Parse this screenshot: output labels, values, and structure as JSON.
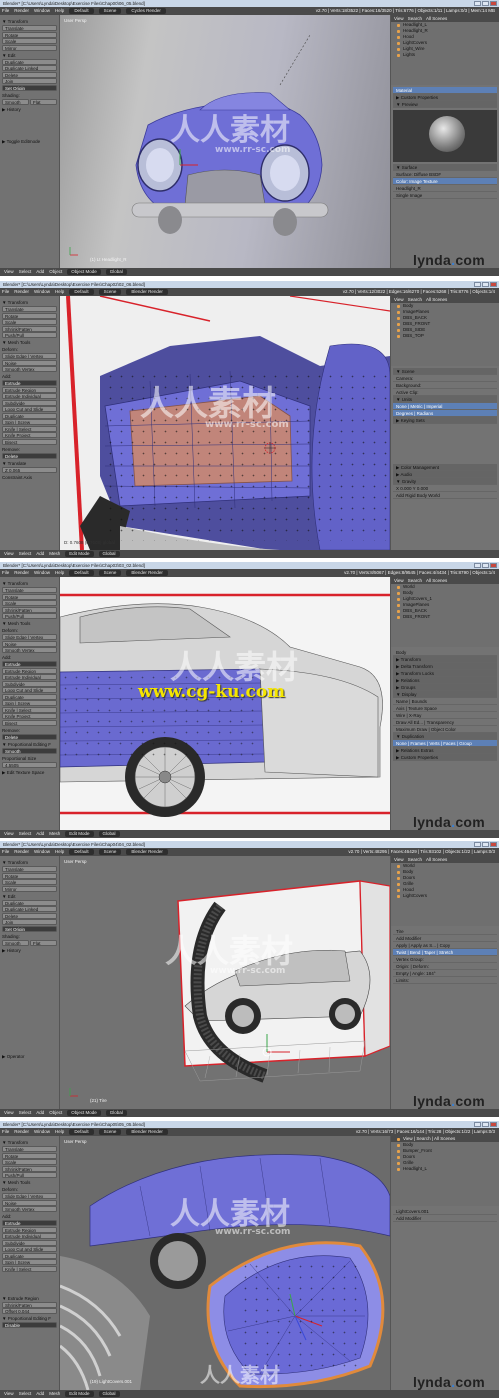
{
  "panels": [
    {
      "title": "Blender* [C:\\Users\\Lynda\\Desktop\\Exercise Files\\Chap00\\06_05.blend]",
      "menu": [
        "File",
        "Render",
        "Window",
        "Help"
      ],
      "layout": "Default",
      "scene": "Scene",
      "engine": "Cycles Render",
      "stats": "v2.70 | Verts:18/3522 | Faces:16/3520 | Tris:6776 | Objects:1/11 | Lamps:0/3 | Mem:14 MB",
      "viewport_label": "User Persp",
      "viewport_bottom": "(1) Lt Headlight_R",
      "mode": "Object Mode",
      "orientation": "Global",
      "bottom_menu": [
        "View",
        "Select",
        "Add",
        "Object"
      ],
      "tools": {
        "sections": [
          {
            "header": "▼ Transform",
            "buttons": [
              "Translate",
              "Rotate",
              "Scale",
              "Mirror"
            ]
          },
          {
            "header": "▼ Edit",
            "buttons": [
              "Duplicate",
              "Duplicate Linked",
              "Delete",
              "Join"
            ]
          },
          {
            "header": "",
            "buttons": [
              "Set Origin"
            ]
          },
          {
            "header": "Shading:",
            "buttons": [
              "Smooth",
              "Flat"
            ]
          },
          {
            "header": "▶ History",
            "buttons": []
          },
          {
            "header": "▶ Toggle Editmode",
            "buttons": []
          }
        ]
      },
      "outliner": [
        "Headlight_L",
        "Headlight_R",
        "Hood",
        "LightCovers",
        "Light_Wire",
        "Lights"
      ],
      "props": [
        "Material",
        "▶ Custom Properties",
        "▼ Preview",
        "▼ Surface",
        "Surface: Diffuse BSDF",
        "Color: Image Texture",
        "Headlight_R",
        "Single Image"
      ],
      "show_lynda": true
    },
    {
      "title": "Blender* [C:\\Users\\Lynda\\Desktop\\Exercise Files\\Chap02\\02_06.blend]",
      "menu": [
        "File",
        "Render",
        "Window",
        "Help"
      ],
      "layout": "Default",
      "scene": "Scene",
      "engine": "Blender Render",
      "stats": "v2.70 | Verts:12/3022 | Edges:16/6270 | Faces:5268 | Tris:8776 | Objects:1/4",
      "viewport_label": "",
      "viewport_bottom": "D: 0.7608 (0.7608) global",
      "mode": "Edit Mode",
      "orientation": "Global",
      "bottom_menu": [
        "View",
        "Select",
        "Add",
        "Mesh"
      ],
      "tools": {
        "sections": [
          {
            "header": "▼ Transform",
            "buttons": [
              "Translate",
              "Rotate",
              "Scale",
              "Shrink/Fatten",
              "Push/Pull"
            ]
          },
          {
            "header": "▼ Mesh Tools",
            "buttons": []
          },
          {
            "header": "Deform:",
            "buttons": [
              "Slide Edge | Vertex",
              "Noise",
              "Smooth Vertex"
            ]
          },
          {
            "header": "Add:",
            "buttons": [
              "Extrude",
              "Extrude Region",
              "Extrude Individual",
              "Subdivide",
              "Loop Cut and Slide",
              "Duplicate",
              "Spin | Screw",
              "Knife | Select",
              "Knife Project",
              "Bisect"
            ]
          },
          {
            "header": "Remove:",
            "buttons": [
              "Delete"
            ]
          },
          {
            "header": "▼ Translate",
            "buttons": [
              "Z 0.065"
            ]
          },
          {
            "header": "Constraint Axis",
            "buttons": []
          }
        ]
      },
      "outliner": [
        "Body",
        "ImagePlanes",
        "DBS_BACK",
        "DBS_FRONT",
        "DBS_SIDE",
        "DBS_TOP"
      ],
      "props": [
        "▼ Scene",
        "Camera:",
        "Background:",
        "Active Clip:",
        "▼ Units",
        "None | Metric | Imperial",
        "Degrees | Radians",
        "▶ Keying Sets",
        "▶ Color Management",
        "▶ Audio",
        "▼ Gravity",
        "X 0.000  Y 0.000",
        "Add Rigid Body World"
      ],
      "show_lynda": false
    },
    {
      "title": "Blender* [C:\\Users\\Lynda\\Desktop\\Exercise Files\\Chap03\\03_02.blend]",
      "menu": [
        "File",
        "Render",
        "Window",
        "Help"
      ],
      "layout": "Default",
      "scene": "Scene",
      "engine": "Blender Render",
      "stats": "v2.70 | Verts:8/5067 | Edges:8/9545 | Faces:4/4434 | Tris:8790 | Objects:1/4",
      "viewport_label": "",
      "viewport_bottom": "",
      "mode": "Edit Mode",
      "orientation": "Global",
      "bottom_menu": [
        "View",
        "Select",
        "Add",
        "Mesh"
      ],
      "tools": {
        "sections": [
          {
            "header": "▼ Transform",
            "buttons": [
              "Translate",
              "Rotate",
              "Scale",
              "Shrink/Fatten",
              "Push/Pull"
            ]
          },
          {
            "header": "▼ Mesh Tools",
            "buttons": []
          },
          {
            "header": "Deform:",
            "buttons": [
              "Slide Edge | Vertex",
              "Noise",
              "Smooth Vertex"
            ]
          },
          {
            "header": "Add:",
            "buttons": [
              "Extrude",
              "Extrude Region",
              "Extrude Individual",
              "Subdivide",
              "Loop Cut and Slide",
              "Duplicate",
              "Spin | Screw",
              "Knife | Select",
              "Knife Project",
              "Bisect"
            ]
          },
          {
            "header": "Remove:",
            "buttons": [
              "Delete"
            ]
          },
          {
            "header": "▼ Proportional Editing F",
            "buttons": [
              "Smooth"
            ]
          },
          {
            "header": "Proportional Size",
            "buttons": [
              "4.5505"
            ]
          },
          {
            "header": "▶ Edit Texture Space",
            "buttons": []
          }
        ]
      },
      "outliner": [
        "World",
        "Body",
        "LightCovers_1",
        "ImagePlanes",
        "DBS_BACK",
        "DBS_FRONT"
      ],
      "props": [
        "Body",
        "▶ Transform",
        "▶ Delta Transform",
        "▶ Transform Locks",
        "▶ Relations",
        "▶ Groups",
        "▼ Display",
        "Name | Bounds",
        "Axis | Texture Space",
        "Wire | X-Ray",
        "Draw All Ed... | Transparency",
        "Maximum Draw | Object Color",
        "▼ Duplication",
        "None | Frames | Verts | Faces | Group",
        "▶ Relations Extras",
        "▶ Custom Properties"
      ],
      "show_lynda": true
    },
    {
      "title": "Blender* [C:\\Users\\Lynda\\Desktop\\Exercise Files\\Chap04\\04_02.blend]",
      "menu": [
        "File",
        "Render",
        "Window",
        "Help"
      ],
      "layout": "Default",
      "scene": "Scene",
      "engine": "Blender Render",
      "stats": "v2.70 | Verts:48295 | Faces:46429 | Tris:93102 | Objects:1/22 | Lamps:0/3",
      "viewport_label": "User Persp",
      "viewport_bottom": "(21) Tire",
      "mode": "Object Mode",
      "orientation": "Global",
      "bottom_menu": [
        "View",
        "Select",
        "Add",
        "Object"
      ],
      "tools": {
        "sections": [
          {
            "header": "▼ Transform",
            "buttons": [
              "Translate",
              "Rotate",
              "Scale",
              "Mirror"
            ]
          },
          {
            "header": "▼ Edit",
            "buttons": [
              "Duplicate",
              "Duplicate Linked",
              "Delete",
              "Join"
            ]
          },
          {
            "header": "",
            "buttons": [
              "Set Origin"
            ]
          },
          {
            "header": "Shading:",
            "buttons": [
              "Smooth",
              "Flat"
            ]
          },
          {
            "header": "▶ History",
            "buttons": []
          },
          {
            "header": "▶ Operator",
            "buttons": []
          }
        ]
      },
      "outliner": [
        "World",
        "Body",
        "Doors",
        "Grille",
        "Hood",
        "LightCovers"
      ],
      "props": [
        "Tire",
        "Add Modifier",
        "Apply | Apply as S... | Copy",
        "Twist | Bend | Taper | Stretch",
        "Vertex Group:",
        "Origin: | Deform:",
        "Empty | Angle: 184°",
        "Limits:"
      ],
      "show_lynda": true
    },
    {
      "title": "Blender* [C:\\Users\\Lynda\\Desktop\\Exercise Files\\Chap05\\05_05.blend]",
      "menu": [
        "File",
        "Render",
        "Window",
        "Help"
      ],
      "layout": "Default",
      "scene": "Scene",
      "engine": "Blender Render",
      "stats": "v2.70 | Verts:16/73 | Faces:16/144 | Tris:28 | Objects:1/22 | Lamps:0/3",
      "viewport_label": "User Persp",
      "viewport_bottom": "(19) LightCovers.001",
      "mode": "Edit Mode",
      "orientation": "Global",
      "bottom_menu": [
        "View",
        "Select",
        "Add",
        "Mesh"
      ],
      "tools": {
        "sections": [
          {
            "header": "▼ Transform",
            "buttons": [
              "Translate",
              "Rotate",
              "Scale",
              "Shrink/Fatten",
              "Push/Pull"
            ]
          },
          {
            "header": "▼ Mesh Tools",
            "buttons": []
          },
          {
            "header": "Deform:",
            "buttons": [
              "Slide Edge | Vertex",
              "Noise",
              "Smooth Vertex"
            ]
          },
          {
            "header": "Add:",
            "buttons": [
              "Extrude",
              "Extrude Region",
              "Extrude Individual",
              "Subdivide",
              "Loop Cut and Slide",
              "Duplicate",
              "Spin | Screw",
              "Knife | Select"
            ]
          },
          {
            "header": "▼ Extrude Region",
            "buttons": [
              "Shrink/Fatten",
              "Offset 0.044"
            ]
          },
          {
            "header": "▼ Proportional Editing F",
            "buttons": [
              "Disable"
            ]
          }
        ]
      },
      "outliner": [
        "View | Search | All Scenes",
        "Body",
        "Bumper_Front",
        "Doors",
        "Grille",
        "Headlight_L"
      ],
      "props": [
        "LightCovers.001",
        "Add Modifier"
      ],
      "show_lynda": true
    }
  ],
  "watermarks": {
    "renren_cn": "人人素材",
    "renren_en": "www.rr-sc.com",
    "cgku_url": "www.cg-ku.com",
    "lynda": "lynda",
    "lynda_dot": ".",
    "lynda_tld": "com"
  },
  "colors": {
    "mesh_blue": "#6f6fd6",
    "ui_header": "#4a4a4a",
    "ui_panel": "#727272",
    "selection_orange": "#e08a3c",
    "reference_red": "#d8222a",
    "url_yellow": "#f5e600"
  }
}
